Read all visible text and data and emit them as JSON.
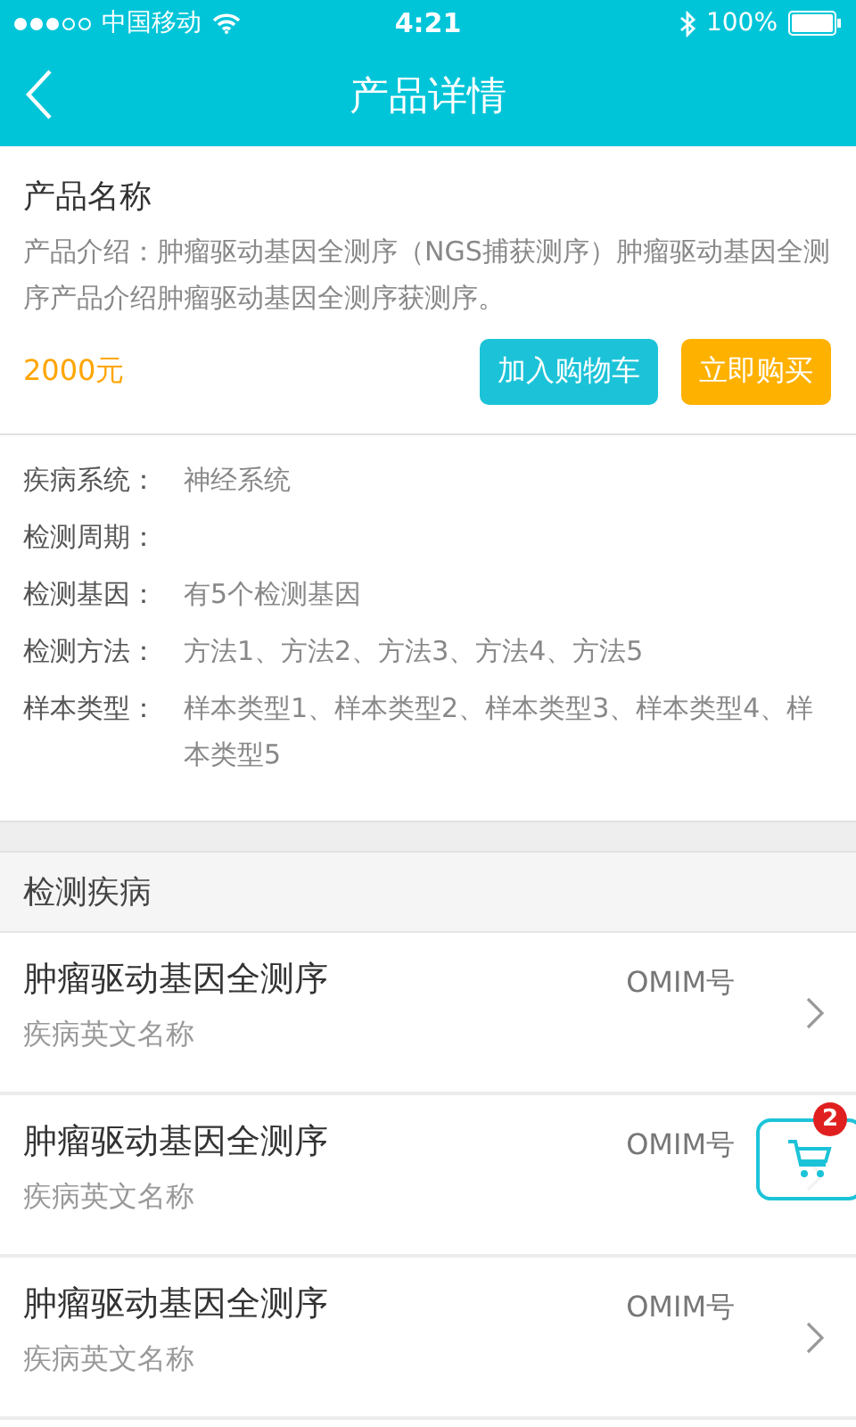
{
  "status_bar": {
    "carrier": "中国移动",
    "time": "4:21",
    "battery": "100%"
  },
  "nav": {
    "title": "产品详情"
  },
  "product": {
    "name": "产品名称",
    "description": "产品介绍：肿瘤驱动基因全测序（NGS捕获测序）肿瘤驱动基因全测序产品介绍肿瘤驱动基因全测序获测序。",
    "price": "2000元",
    "buttons": [
      {
        "label": "加入购物车",
        "kind": "cart"
      },
      {
        "label": "立即购买",
        "kind": "buy"
      }
    ]
  },
  "details": [
    {
      "label": "疾病系统：",
      "value": "神经系统"
    },
    {
      "label": "检测周期："
    },
    {
      "label": "检测基因：",
      "value": "有5个检测基因"
    },
    {
      "label": "检测方法：",
      "value": "方法1、方法2、方法3、方法4、方法5"
    },
    {
      "label": "样本类型：",
      "value": "样本类型1、样本类型2、样本类型3、样本类型4、样本类型5"
    }
  ],
  "diseases": {
    "heading": "检测疾病",
    "rows": [
      {
        "name": "肿瘤驱动基因全测序",
        "english_name": "疾病英文名称",
        "omim": "OMIM号"
      },
      {
        "name": "肿瘤驱动基因全测序",
        "english_name": "疾病英文名称",
        "omim": "OMIM号"
      },
      {
        "name": "肿瘤驱动基因全测序",
        "english_name": "疾病英文名称",
        "omim": "OMIM号"
      }
    ]
  },
  "floating_cart": {
    "count": "2"
  }
}
